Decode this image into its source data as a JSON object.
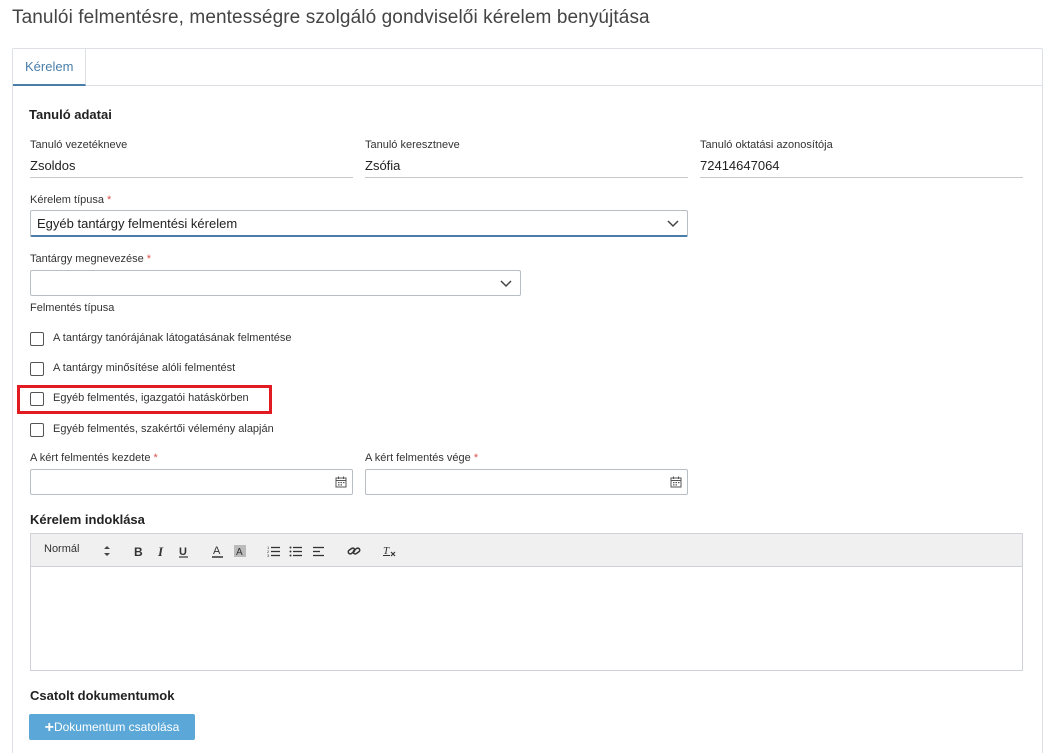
{
  "page_title": "Tanulói felmentésre, mentességre szolgáló gondviselői kérelem benyújtása",
  "tabs": [
    {
      "label": "Kérelem"
    }
  ],
  "student": {
    "section_title": "Tanuló adatai",
    "last_name_label": "Tanuló vezetékneve",
    "last_name_value": "Zsoldos",
    "first_name_label": "Tanuló keresztneve",
    "first_name_value": "Zsófia",
    "id_label": "Tanuló oktatási azonosítója",
    "id_value": "72414647064"
  },
  "request_type": {
    "label": "Kérelem típusa",
    "required_mark": "*",
    "value": "Egyéb tantárgy felmentési kérelem"
  },
  "subject": {
    "label": "Tantárgy megnevezése",
    "required_mark": "*",
    "value": ""
  },
  "exemption_type": {
    "label": "Felmentés típusa",
    "options": [
      {
        "label": "A tantárgy tanórájának látogatásának felmentése",
        "checked": false
      },
      {
        "label": "A tantárgy minősítése alóli felmentést",
        "checked": false
      },
      {
        "label": "Egyéb felmentés, igazgatói hatáskörben",
        "checked": false
      },
      {
        "label": "Egyéb felmentés, szakértői vélemény alapján",
        "checked": false
      }
    ]
  },
  "dates": {
    "start_label": "A kért felmentés kezdete",
    "end_label": "A kért felmentés vége",
    "required_mark": "*",
    "start_value": "",
    "end_value": ""
  },
  "justification": {
    "section_title": "Kérelem indoklása",
    "format_label": "Normál",
    "body": ""
  },
  "attachments": {
    "section_title": "Csatolt dokumentumok",
    "button_label": "Dokumentum csatolása",
    "button_icon": "+"
  },
  "colors": {
    "accent": "#4a7ea8",
    "required": "#d9534f",
    "highlight": "#e21b23",
    "button": "#5ba8d8"
  }
}
